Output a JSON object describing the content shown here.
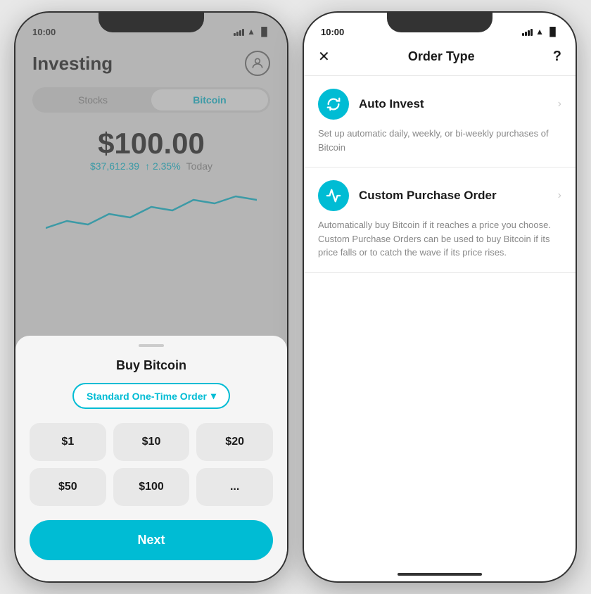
{
  "left_phone": {
    "status": {
      "time": "10:00"
    },
    "header": {
      "title": "Investing",
      "profile_icon": "👤"
    },
    "tabs": [
      {
        "label": "Stocks",
        "active": false
      },
      {
        "label": "Bitcoin",
        "active": true
      }
    ],
    "price": {
      "amount": "$100.00",
      "btc_price": "$37,612.39",
      "change": "↑ 2.35%",
      "period": "Today"
    },
    "modal": {
      "title": "Buy Bitcoin",
      "order_type": "Standard One-Time Order",
      "amounts": [
        "$1",
        "$10",
        "$20",
        "$50",
        "$100",
        "..."
      ],
      "next_label": "Next"
    }
  },
  "right_phone": {
    "status": {
      "time": "10:00"
    },
    "header": {
      "title": "Order Type",
      "close": "✕",
      "help": "?"
    },
    "order_items": [
      {
        "id": "auto_invest",
        "icon": "↻",
        "label": "Auto Invest",
        "description": "Set up automatic daily, weekly, or bi-weekly purchases of Bitcoin"
      },
      {
        "id": "custom_purchase",
        "icon": "⌇",
        "label": "Custom Purchase Order",
        "description": "Automatically buy Bitcoin if it reaches a price you choose. Custom Purchase Orders can be used to buy Bitcoin if its price falls or to catch the wave if its price rises."
      }
    ],
    "colors": {
      "accent": "#00bcd4"
    }
  }
}
